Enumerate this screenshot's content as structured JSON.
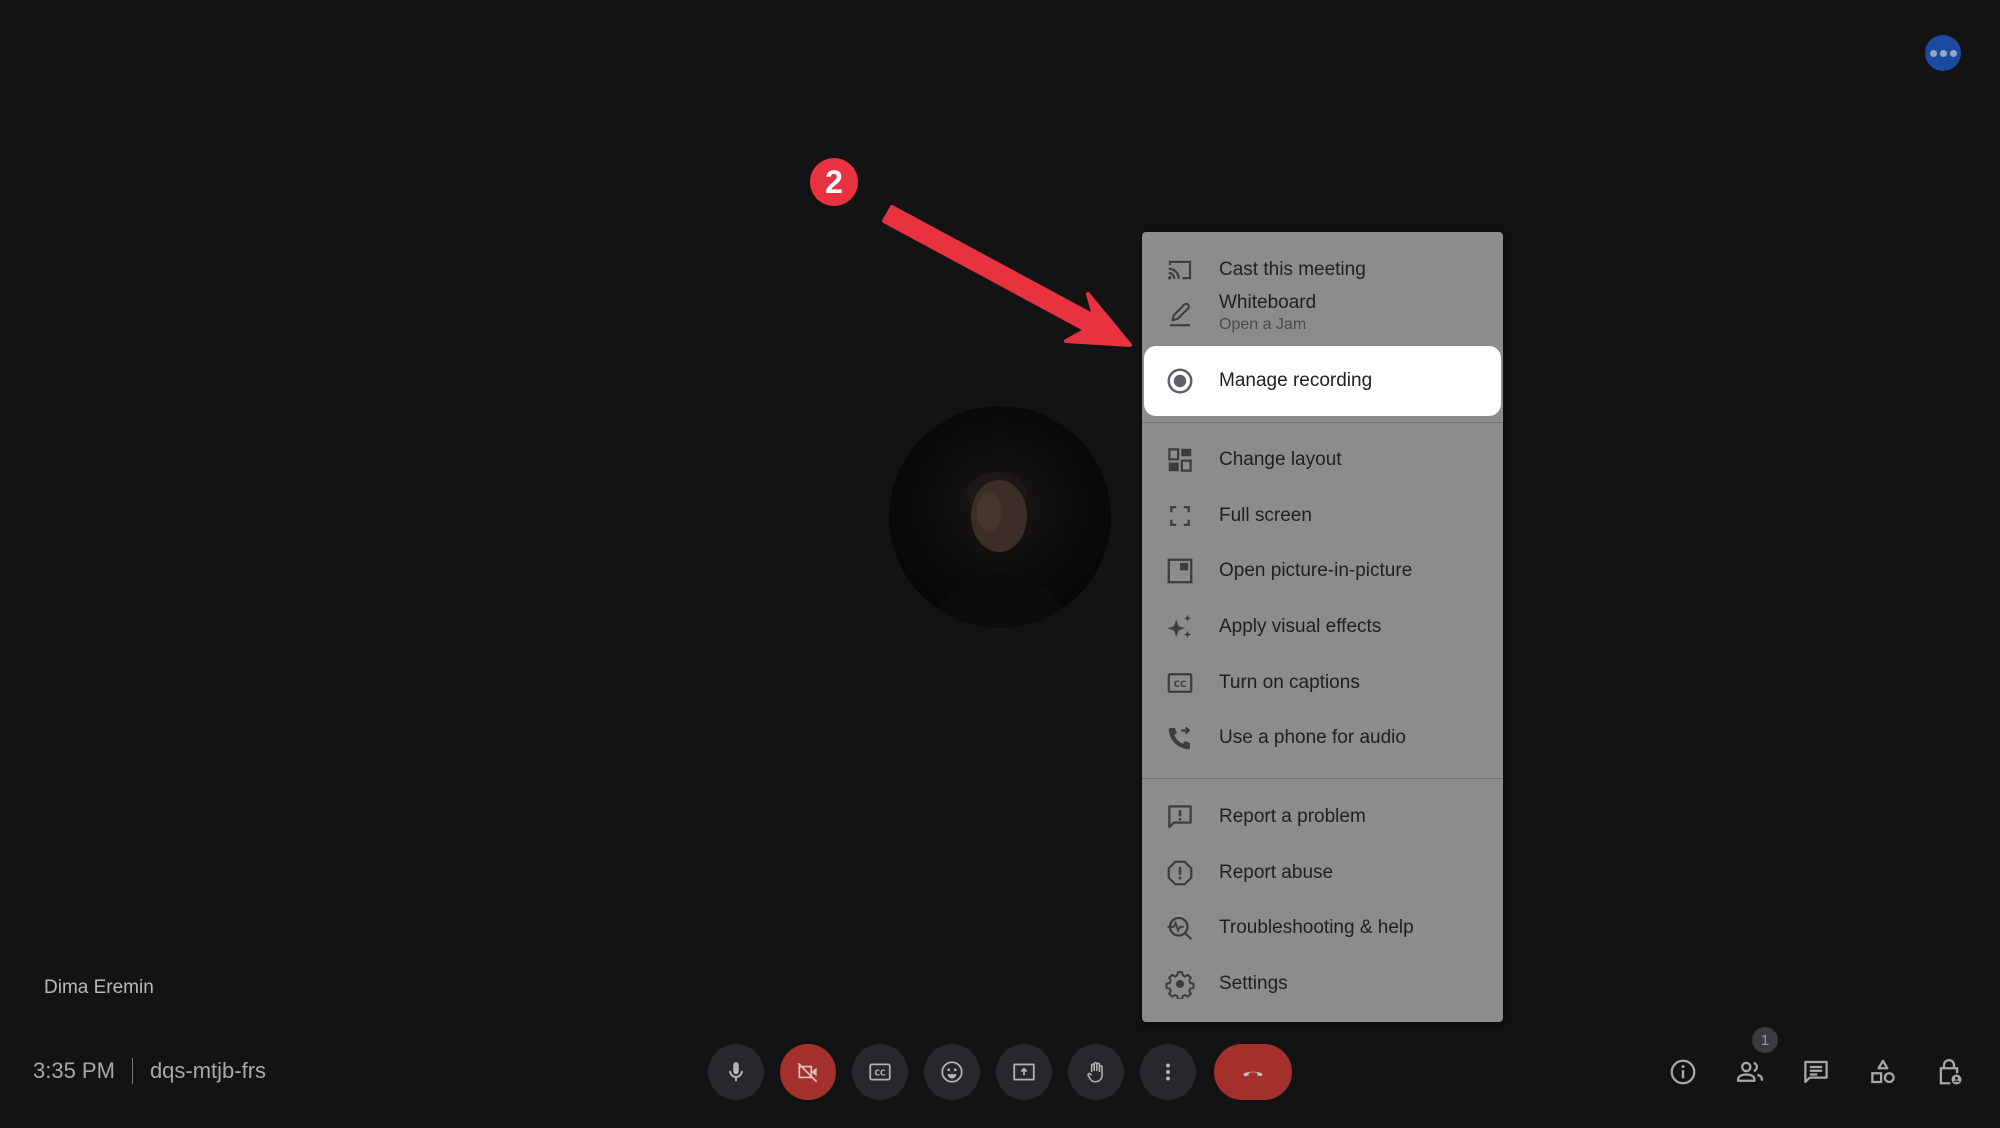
{
  "participant": {
    "name": "Dima Eremin"
  },
  "meeting": {
    "time": "3:35 PM",
    "code": "dqs-mtjb-frs"
  },
  "top_right": {
    "icon": "more-horiz-icon",
    "color": "#1b4ba0"
  },
  "controls": [
    {
      "id": "mic",
      "icon": "microphone-icon",
      "state": "on"
    },
    {
      "id": "camera",
      "icon": "camera-off-icon",
      "state": "off"
    },
    {
      "id": "captions",
      "icon": "closed-captions-icon"
    },
    {
      "id": "reactions",
      "icon": "emoji-icon"
    },
    {
      "id": "present",
      "icon": "present-screen-icon"
    },
    {
      "id": "raise-hand",
      "icon": "hand-icon"
    },
    {
      "id": "more-options",
      "icon": "more-vert-icon"
    },
    {
      "id": "leave-call",
      "icon": "end-call-icon"
    }
  ],
  "right_controls": [
    {
      "id": "meeting-details",
      "icon": "info-icon"
    },
    {
      "id": "people",
      "icon": "people-icon",
      "badge": "1"
    },
    {
      "id": "chat",
      "icon": "chat-icon"
    },
    {
      "id": "activities",
      "icon": "shapes-icon"
    },
    {
      "id": "host-controls",
      "icon": "lock-person-icon"
    }
  ],
  "menu": {
    "items": [
      {
        "label": "Cast this meeting",
        "icon": "cast-icon"
      },
      {
        "label": "Whiteboard",
        "sublabel": "Open a Jam",
        "icon": "pencil-icon"
      },
      {
        "label": "Manage recording",
        "icon": "record-icon",
        "highlighted": true
      },
      {
        "label": "Change layout",
        "icon": "layout-icon"
      },
      {
        "label": "Full screen",
        "icon": "fullscreen-icon"
      },
      {
        "label": "Open picture-in-picture",
        "icon": "picture-in-picture-icon"
      },
      {
        "label": "Apply visual effects",
        "icon": "sparkle-icon"
      },
      {
        "label": "Turn on captions",
        "icon": "closed-captions-icon"
      },
      {
        "label": "Use a phone for audio",
        "icon": "phone-forward-icon"
      },
      {
        "label": "Report a problem",
        "icon": "report-problem-icon"
      },
      {
        "label": "Report abuse",
        "icon": "report-abuse-icon"
      },
      {
        "label": "Troubleshooting & help",
        "icon": "troubleshoot-icon"
      },
      {
        "label": "Settings",
        "icon": "gear-icon"
      }
    ]
  },
  "annotation": {
    "step": "2",
    "color": "#e8323f"
  },
  "colors": {
    "background": "#131314",
    "menu": "#8c8c8c",
    "danger": "#a3302a"
  }
}
